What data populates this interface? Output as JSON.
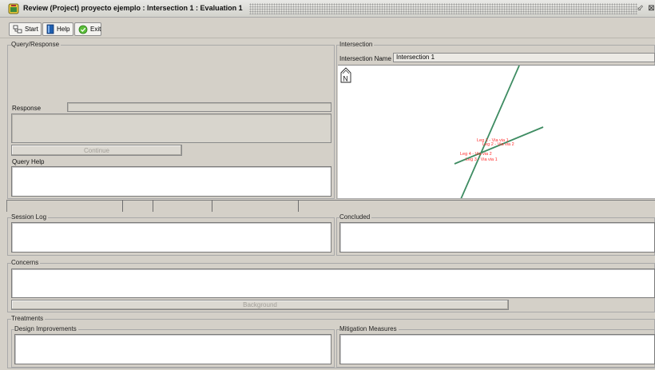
{
  "window": {
    "title": "Review (Project) proyecto ejemplo : Intersection 1 : Evaluation 1",
    "icon": "app-icon",
    "controls": [
      "restore-icon",
      "maximize-icon"
    ]
  },
  "toolbar": {
    "start_label": "Start",
    "help_label": "Help",
    "exit_label": "Exit"
  },
  "query_response": {
    "title": "Query/Response",
    "response_label": "Response",
    "continue_label": "Continue",
    "query_help_label": "Query Help"
  },
  "intersection": {
    "title": "Intersection",
    "name_label": "Intersection Name",
    "name_value": "Intersection 1",
    "north_label": "N",
    "legs": [
      "Leg 1 - Via via 1",
      "Leg 2 - Via via 2",
      "Leg 4 - Via via 2",
      "Leg 3 - Via via 1"
    ],
    "colors": {
      "road": "#3e8c62",
      "leg_label": "#ff2a2a"
    }
  },
  "sections": {
    "session_log": "Session Log",
    "concluded": "Concluded",
    "concerns": "Concerns",
    "background_label": "Background",
    "treatments": "Treatments",
    "design_improvements": "Design Improvements",
    "mitigation_measures": "Mitigation Measures"
  }
}
